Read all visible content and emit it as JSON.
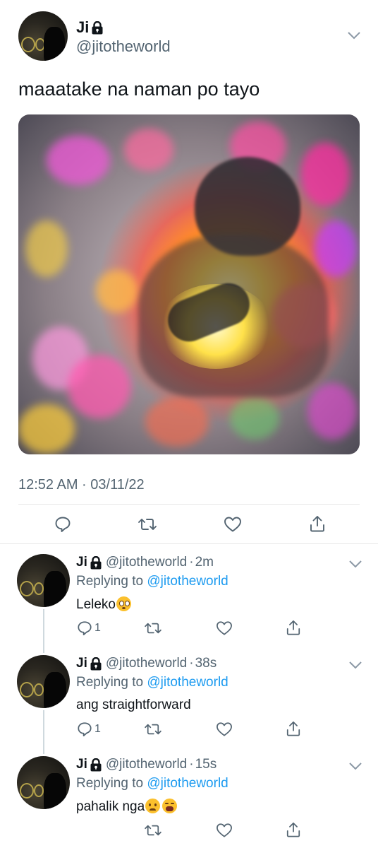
{
  "main_tweet": {
    "display_name": "Ji",
    "handle": "@jitotheworld",
    "text": "maaatake na naman po tayo",
    "timestamp": "12:52 AM · 03/11/22",
    "image_icon": "glowing-figure-holding-light-meme"
  },
  "replies": [
    {
      "display_name": "Ji",
      "handle": "@jitotheworld",
      "time": "2m",
      "replying_prefix": "Replying to",
      "replying_to": "@jitotheworld",
      "text": "Leleko",
      "emojis": [
        "flushed-face-emoji"
      ],
      "reply_count": "1"
    },
    {
      "display_name": "Ji",
      "handle": "@jitotheworld",
      "time": "38s",
      "replying_prefix": "Replying to",
      "replying_to": "@jitotheworld",
      "text": "ang straightforward",
      "emojis": [],
      "reply_count": "1"
    },
    {
      "display_name": "Ji",
      "handle": "@jitotheworld",
      "time": "15s",
      "replying_prefix": "Replying to",
      "replying_to": "@jitotheworld",
      "text": "pahalik nga",
      "emojis": [
        "worried-face-emoji",
        "tired-face-emoji"
      ],
      "reply_count": ""
    }
  ],
  "colors": {
    "text": "#0f1419",
    "secondary": "#536471",
    "link": "#1d9bf0",
    "divider": "#e7e7e7",
    "thread_line": "#cfd9de"
  }
}
